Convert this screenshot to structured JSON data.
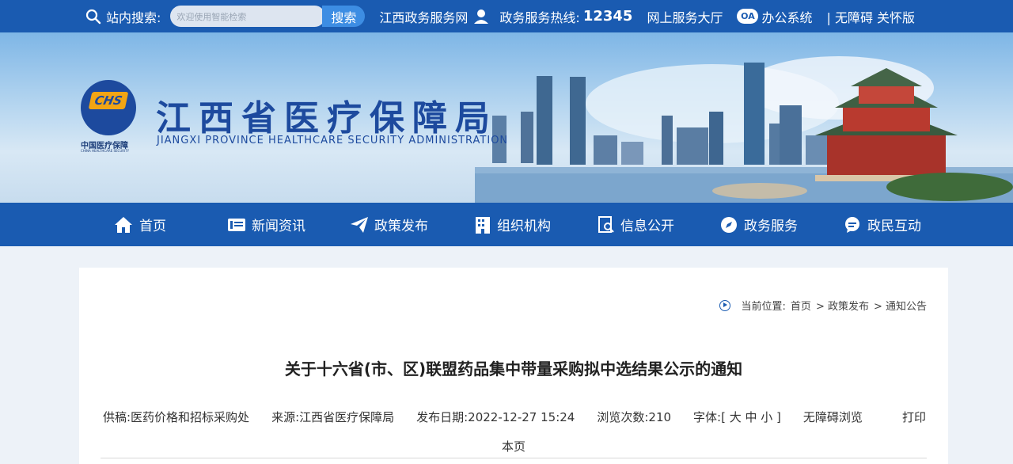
{
  "topbar": {
    "search_label": "站内搜索:",
    "search_placeholder": "欢迎使用智能检索",
    "search_button": "搜索",
    "portal_link": "江西政务服务网",
    "hotline_label": "政务服务热线:",
    "hotline_number": "12345",
    "hall_link": "网上服务大厅",
    "oa_badge": "OA",
    "office_link": "办公系统",
    "accessibility_link": "| 无障碍 关怀版",
    "accent_color": "#1a5bb1"
  },
  "banner": {
    "logo_text": "CHS",
    "logo_caption": "中国医疗保障",
    "logo_caption_en": "CHINA HEALTHCARE SECURITY",
    "title_cn": "江西省医疗保障局",
    "title_en": "JIANGXI PROVINCE HEALTHCARE SECURITY ADMINISTRATION"
  },
  "nav": {
    "items": [
      {
        "label": "首页",
        "icon": "home-icon"
      },
      {
        "label": "新闻资讯",
        "icon": "news-icon"
      },
      {
        "label": "政策发布",
        "icon": "send-icon"
      },
      {
        "label": "组织机构",
        "icon": "building-icon"
      },
      {
        "label": "信息公开",
        "icon": "document-search-icon"
      },
      {
        "label": "政务服务",
        "icon": "compass-icon"
      },
      {
        "label": "政民互动",
        "icon": "chat-icon"
      }
    ]
  },
  "breadcrumb": {
    "prefix": "当前位置:",
    "items": [
      "首页",
      "> 政策发布",
      "> 通知公告"
    ]
  },
  "article": {
    "title": "关于十六省(市、区)联盟药品集中带量采购拟中选结果公示的通知",
    "supplier": "供稿:医药价格和招标采购处",
    "source": "来源:江西省医疗保障局",
    "date": "发布日期:2022-12-27 15:24",
    "views": "浏览次数:210",
    "font_size": "字体:[ 大 中 小 ]",
    "accessible_browse": "无障碍浏览",
    "print": "打印",
    "this_page": "本页"
  }
}
